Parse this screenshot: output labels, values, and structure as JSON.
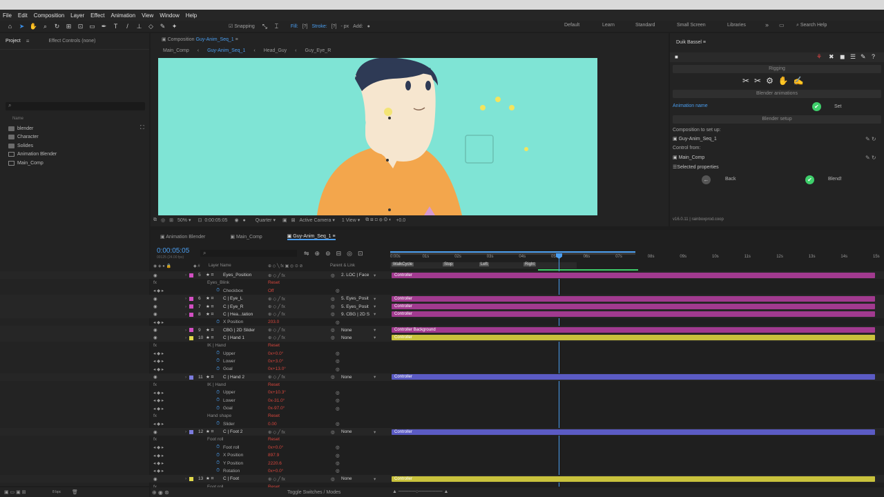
{
  "menu": [
    "File",
    "Edit",
    "Composition",
    "Layer",
    "Effect",
    "Animation",
    "View",
    "Window",
    "Help"
  ],
  "toolbar": {
    "snapping": "Snapping",
    "fill": "Fill:",
    "stroke": "Stroke:",
    "stroke_unit": "- px",
    "add": "Add:",
    "workspaces": [
      "Default",
      "Learn",
      "Standard",
      "Small Screen",
      "Libraries"
    ],
    "active_workspace": "Small Screen",
    "search_placeholder": "Search Help"
  },
  "project_panel": {
    "tabs": [
      "Project",
      "Effect Controls (none)"
    ],
    "name_header": "Name",
    "items": [
      {
        "name": "blender",
        "type": "folder"
      },
      {
        "name": "Character",
        "type": "folder"
      },
      {
        "name": "Solides",
        "type": "folder"
      },
      {
        "name": "Animation Blender",
        "type": "comp"
      },
      {
        "name": "Main_Comp",
        "type": "comp"
      }
    ],
    "bpc": "8 bpc"
  },
  "composition_panel": {
    "title_prefix": "Composition",
    "title": "Guy-Anim_Seq_1",
    "breadcrumbs": [
      "Main_Comp",
      "Guy-Anim_Seq_1",
      "Head_Guy",
      "Guy_Eye_R"
    ],
    "zoom": "50%",
    "timecode": "0:00:05:05",
    "resolution": "Quarter",
    "camera": "Active Camera",
    "views": "1 View",
    "exposure": "+0.0"
  },
  "duik": {
    "title": "Duik Bassel",
    "section_rigging": "Rigging",
    "section_blender_anim": "Blender animations",
    "animation_name_label": "Animation name",
    "set_label": "Set",
    "blender_setup": "Blender setup",
    "comp_to_setup_label": "Composition to set up:",
    "comp_to_setup": "Guy-Anim_Seq_1",
    "control_from_label": "Control from:",
    "control_from": "Main_Comp",
    "selected_properties": "Selected properties",
    "back": "Back",
    "blend": "Blend!",
    "version": "v16.0.11 | rainboxprod.coop"
  },
  "timeline": {
    "tabs": [
      "Animation Blender",
      "Main_Comp",
      "Guy-Anim_Seq_1"
    ],
    "active_tab": "Guy-Anim_Seq_1",
    "timecode": "0:00:05:05",
    "timecode_sub": "00125 (24.00 fps)",
    "col_layer_name": "Layer Name",
    "col_parent": "Parent & Link",
    "ruler": [
      "0:00s",
      "01s",
      "02s",
      "03s",
      "04s",
      "05s",
      "06s",
      "07s",
      "08s",
      "09s",
      "10s",
      "11s",
      "12s",
      "13s",
      "14s",
      "15s"
    ],
    "markers": [
      "WalkCycle",
      "Stop",
      "Left",
      "Right"
    ],
    "footer": "Toggle Switches / Modes",
    "rows": [
      {
        "kind": "layer",
        "num": "5",
        "name": "Eyes_Position",
        "parent": "2. LOC | Face",
        "color": "#d24fc2",
        "bar": "Controller",
        "barcolor": "#a13a8f"
      },
      {
        "kind": "effect",
        "name": "Eyes_Blink",
        "value": "Reset"
      },
      {
        "kind": "prop",
        "name": "Checkbox",
        "value": "Off"
      },
      {
        "kind": "layer",
        "num": "6",
        "name": "C | Eye_L",
        "parent": "5. Eyes_Posit",
        "color": "#d24fc2",
        "bar": "Controller",
        "barcolor": "#a13a8f"
      },
      {
        "kind": "layer",
        "num": "7",
        "name": "C | Eye_R",
        "parent": "5. Eyes_Posit",
        "color": "#d24fc2",
        "bar": "Controller",
        "barcolor": "#a13a8f"
      },
      {
        "kind": "layer",
        "num": "8",
        "name": "C | Hea...tation",
        "parent": "9. CBG | 2D S",
        "color": "#d24fc2",
        "bar": "Controller",
        "barcolor": "#a13a8f"
      },
      {
        "kind": "prop",
        "name": "X Position",
        "value": "203.0"
      },
      {
        "kind": "layer",
        "num": "9",
        "name": "CBG | 2D Slider",
        "parent": "None",
        "color": "#d24fc2",
        "bar": "Controller Background",
        "barcolor": "#a13a8f"
      },
      {
        "kind": "layer",
        "num": "10",
        "name": "C | Hand 1",
        "parent": "None",
        "color": "#e0d84a",
        "bar": "Controller",
        "barcolor": "#c9c23c"
      },
      {
        "kind": "effect",
        "name": "IK | Hand",
        "value": "Reset"
      },
      {
        "kind": "prop",
        "name": "Upper",
        "value": "0x+0.0°"
      },
      {
        "kind": "prop",
        "name": "Lower",
        "value": "0x+3.0°"
      },
      {
        "kind": "prop",
        "name": "Goal",
        "value": "0x+13.0°"
      },
      {
        "kind": "layer",
        "num": "11",
        "name": "C | Hand 2",
        "parent": "None",
        "color": "#7b7bdc",
        "bar": "Controller",
        "barcolor": "#5b5bc4"
      },
      {
        "kind": "effect",
        "name": "IK | Hand",
        "value": "Reset"
      },
      {
        "kind": "prop",
        "name": "Upper",
        "value": "0x+10.3°"
      },
      {
        "kind": "prop",
        "name": "Lower",
        "value": "0x-31.0°"
      },
      {
        "kind": "prop",
        "name": "Goal",
        "value": "0x-97.0°"
      },
      {
        "kind": "effect",
        "name": "Hand shape",
        "value": "Reset"
      },
      {
        "kind": "prop",
        "name": "Slider",
        "value": "0.00"
      },
      {
        "kind": "layer",
        "num": "12",
        "name": "C | Foot 2",
        "parent": "None",
        "color": "#7b7bdc",
        "bar": "Controller",
        "barcolor": "#5b5bc4"
      },
      {
        "kind": "effect",
        "name": "Foot roll",
        "value": "Reset"
      },
      {
        "kind": "prop",
        "name": "Foot roll",
        "value": "0x+0.0°"
      },
      {
        "kind": "prop",
        "name": "X Position",
        "value": "897.9"
      },
      {
        "kind": "prop",
        "name": "Y Position",
        "value": "2220.6"
      },
      {
        "kind": "prop",
        "name": "Rotation",
        "value": "0x+0.0°"
      },
      {
        "kind": "layer",
        "num": "13",
        "name": "C | Foot",
        "parent": "None",
        "color": "#e0d84a",
        "bar": "Controller",
        "barcolor": "#c9c23c"
      },
      {
        "kind": "effect",
        "name": "Foot roll",
        "value": "Reset"
      }
    ]
  }
}
